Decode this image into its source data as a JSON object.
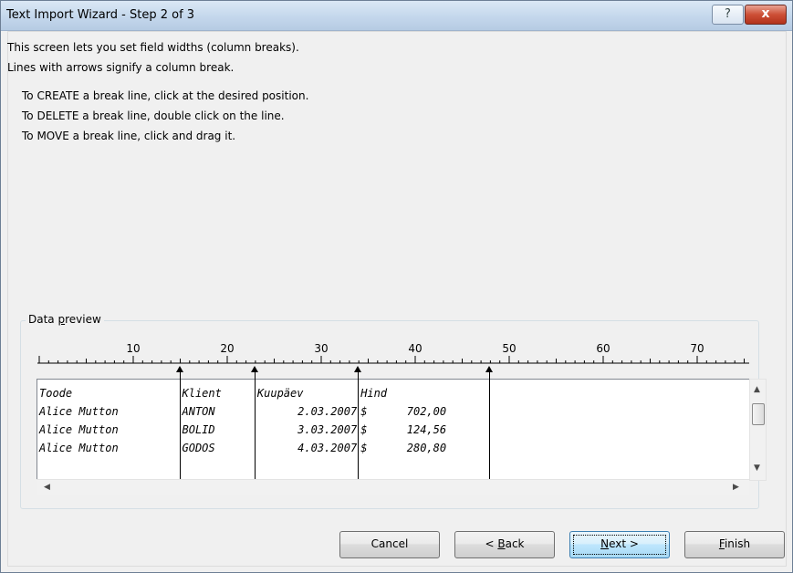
{
  "window": {
    "title": "Text Import Wizard - Step 2 of 3",
    "help_glyph": "?",
    "close_glyph": "x"
  },
  "intro": {
    "line1": "This screen lets you set field widths (column breaks).",
    "line2": "Lines with arrows signify a column break."
  },
  "instructions": [
    "To CREATE a break line, click at the desired position.",
    "To DELETE a break line, double click on the line.",
    "To MOVE a break line, click and drag it."
  ],
  "data_preview": {
    "legend_pre": "Data ",
    "legend_underlined": "p",
    "legend_post": "review",
    "ruler_ticks": [
      "10",
      "20",
      "30",
      "40",
      "50",
      "60",
      "70"
    ],
    "break_positions": [
      15,
      23,
      34,
      48
    ],
    "rows": [
      [
        "Toode",
        "Klient",
        "Kuupäev",
        "Hind"
      ],
      [
        "Alice Mutton",
        "ANTON",
        "2.03.2007",
        "$      702,00"
      ],
      [
        "Alice Mutton",
        "BOLID",
        "3.03.2007",
        "$      124,56"
      ],
      [
        "Alice Mutton",
        "GODOS",
        "4.03.2007",
        "$      280,80"
      ]
    ]
  },
  "buttons": {
    "cancel": "Cancel",
    "back_pre": "< ",
    "back_underlined": "B",
    "back_post": "ack",
    "next_underlined": "N",
    "next_post": "ext >",
    "finish_underlined": "F",
    "finish_post": "inish"
  }
}
